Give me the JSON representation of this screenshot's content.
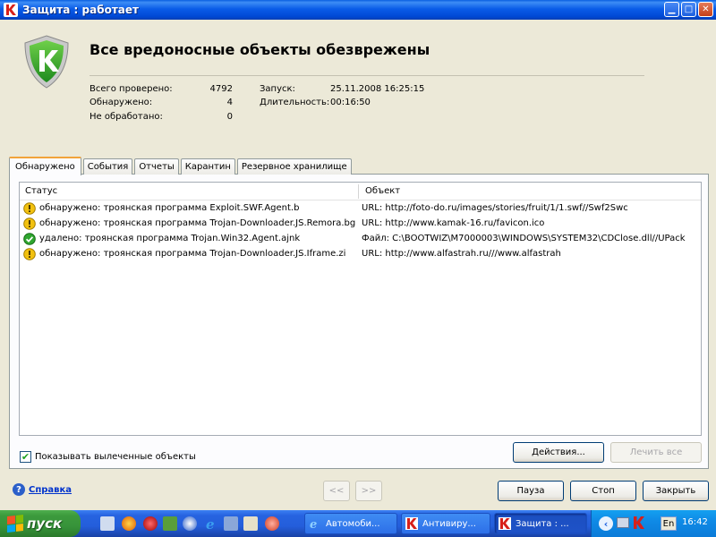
{
  "window": {
    "title": "Защита : работает",
    "minimize_icon": "minimize-icon",
    "maximize_icon": "maximize-icon",
    "close_icon": "close-icon"
  },
  "header": {
    "headline": "Все вредоносные объекты обезврежены",
    "stats": {
      "checked_label": "Всего проверено:",
      "checked_value": "4792",
      "detected_label": "Обнаружено:",
      "detected_value": "4",
      "unprocessed_label": "Не обработано:",
      "unprocessed_value": "0",
      "launch_label": "Запуск:",
      "launch_value": "25.11.2008 16:25:15",
      "duration_label": "Длительность:",
      "duration_value": "00:16:50"
    }
  },
  "tabs": [
    {
      "label": "Обнаружено",
      "active": true
    },
    {
      "label": "События",
      "active": false
    },
    {
      "label": "Отчеты",
      "active": false
    },
    {
      "label": "Карантин",
      "active": false
    },
    {
      "label": "Резервное хранилище",
      "active": false
    }
  ],
  "table": {
    "columns": [
      "Статус",
      "Объект"
    ],
    "rows": [
      {
        "icon": "warning-icon",
        "status": "обнаружено: троянская программа Exploit.SWF.Agent.b",
        "object": "URL: http://foto-do.ru/images/stories/fruit/1/1.swf//Swf2Swc"
      },
      {
        "icon": "warning-icon",
        "status": "обнаружено: троянская программа Trojan-Downloader.JS.Remora.bg",
        "object": "URL: http://www.kamak-16.ru/favicon.ico"
      },
      {
        "icon": "success-check-icon",
        "status": "удалено: троянская программа Trojan.Win32.Agent.ajnk",
        "object": "Файл: C:\\BOOTWIZ\\M7000003\\WINDOWS\\SYSTEM32\\CDClose.dll//UPack"
      },
      {
        "icon": "warning-icon",
        "status": "обнаружено: троянская программа Trojan-Downloader.JS.Iframe.zi",
        "object": "URL: http://www.alfastrah.ru///www.alfastrah"
      }
    ]
  },
  "show_cured": {
    "label": "Показывать вылеченные объекты",
    "checked": true
  },
  "buttons": {
    "actions": "Действия...",
    "cure_all": "Лечить все",
    "prev": "<<",
    "next": ">>",
    "pause": "Пауза",
    "stop": "Стоп",
    "close": "Закрыть"
  },
  "help": {
    "label": "Справка"
  },
  "taskbar": {
    "start_label": "пуск",
    "tasks": [
      {
        "label": "Автомоби...",
        "icon": "ie-icon",
        "active": false
      },
      {
        "label": "Антивиру...",
        "icon": "kaspersky-icon",
        "active": false
      },
      {
        "label": "Защита : ...",
        "icon": "kaspersky-icon",
        "active": true
      }
    ],
    "language": "En",
    "clock": "16:42"
  },
  "colors": {
    "accent_blue": "#0a5fe0",
    "warning": "#f2c10f",
    "success": "#2fa62f",
    "kaspersky_red": "#d7201a"
  }
}
